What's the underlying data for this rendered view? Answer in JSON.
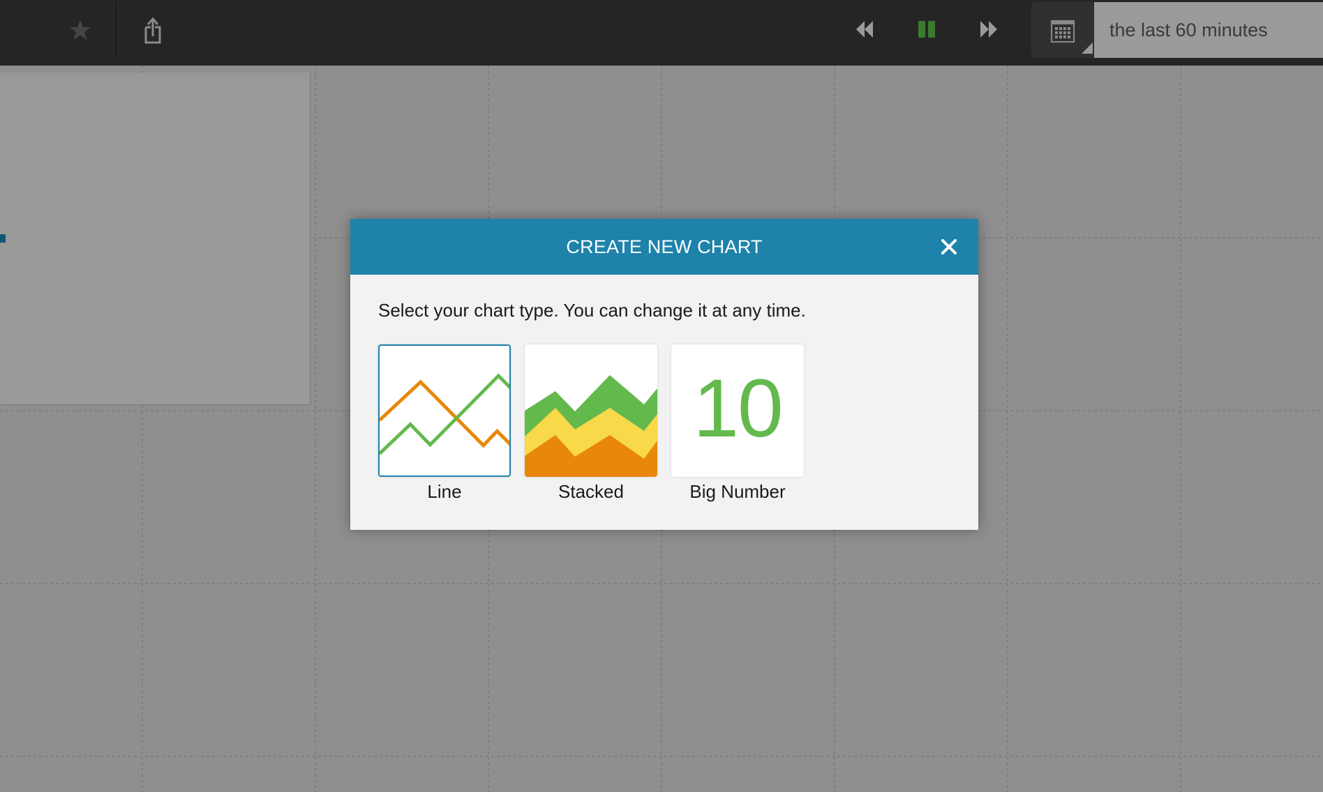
{
  "topbar": {
    "favorite_icon": "star-icon",
    "share_icon": "share-icon",
    "playback": {
      "rewind_icon": "rewind-icon",
      "pause_icon": "pause-icon",
      "forward_icon": "fast-forward-icon",
      "pause_color": "#3c7a30"
    },
    "calendar_icon": "calendar-icon",
    "time_range_value": "the last 60 minutes"
  },
  "modal": {
    "title": "CREATE NEW CHART",
    "close_icon": "close-icon",
    "instruction": "Select your chart type. You can change it at any time.",
    "accent_color": "#1e82aa",
    "options": [
      {
        "label": "Line",
        "selected": true
      },
      {
        "label": "Stacked",
        "selected": false
      },
      {
        "label": "Big Number",
        "selected": false,
        "preview_value": "10"
      }
    ]
  },
  "colors": {
    "green": "#63b94b",
    "orange": "#e8870a",
    "yellow": "#f7d949"
  }
}
